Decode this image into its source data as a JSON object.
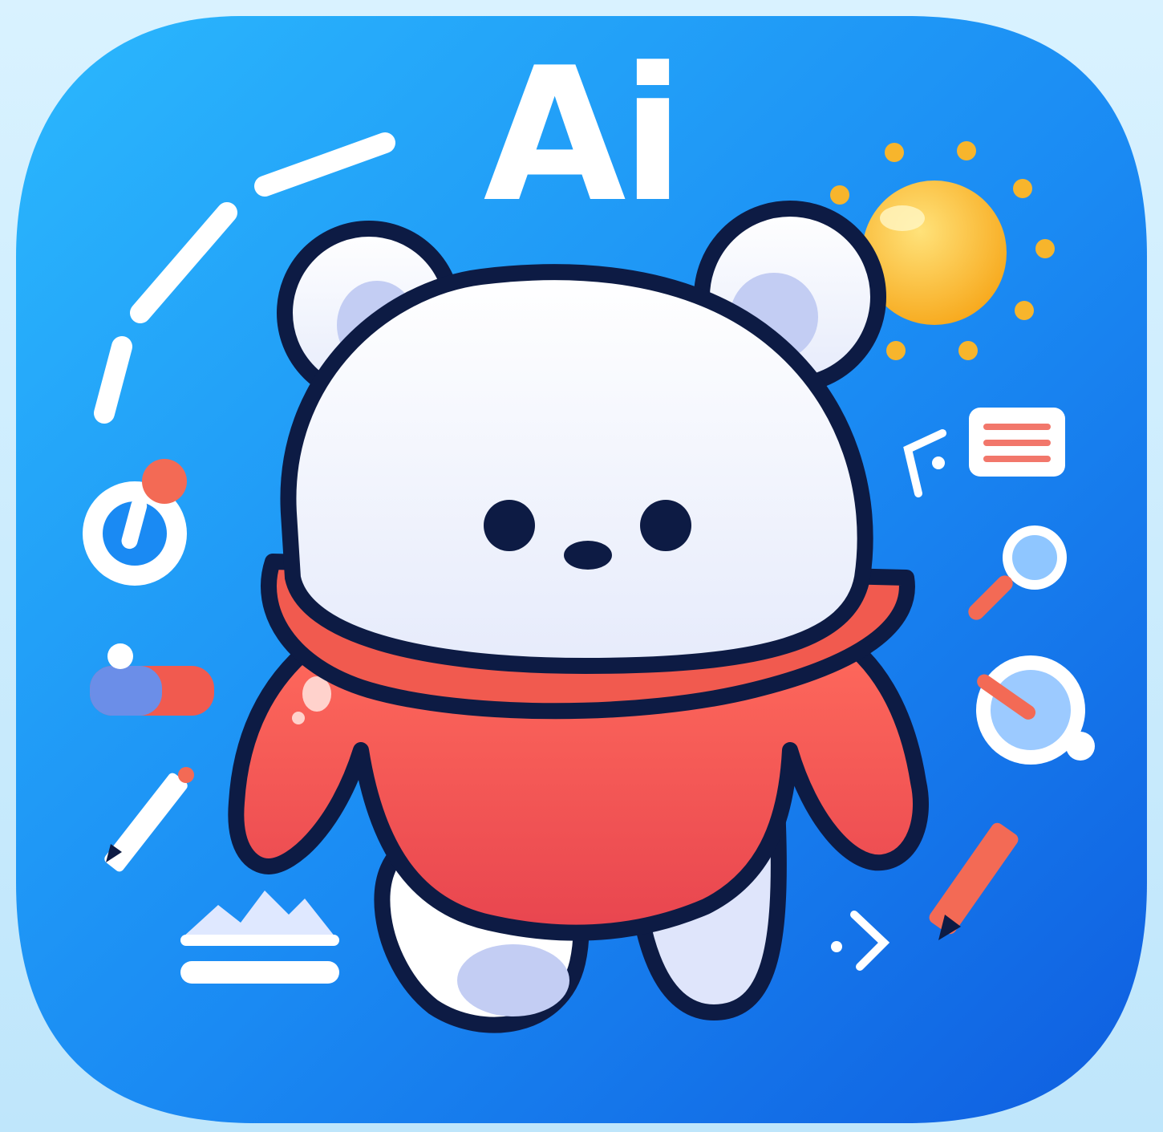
{
  "app_icon": {
    "title_text": "Ai",
    "mascot": "bear-mascot",
    "colors": {
      "background": "#1d86f2",
      "background_light": "#27b4fb",
      "sweater": "#f15a4f",
      "bear_fur": "#ffffff",
      "bear_inner": "#c8d1f4",
      "outline": "#0d1b44",
      "sun": "#fcb63a"
    },
    "decorations": [
      "sun-icon",
      "document-icon",
      "magnifier-icon",
      "compass-icon",
      "pencil-icon",
      "mountain-image-icon",
      "timer-icon",
      "toggle-icon",
      "code-arrow-icon"
    ]
  }
}
